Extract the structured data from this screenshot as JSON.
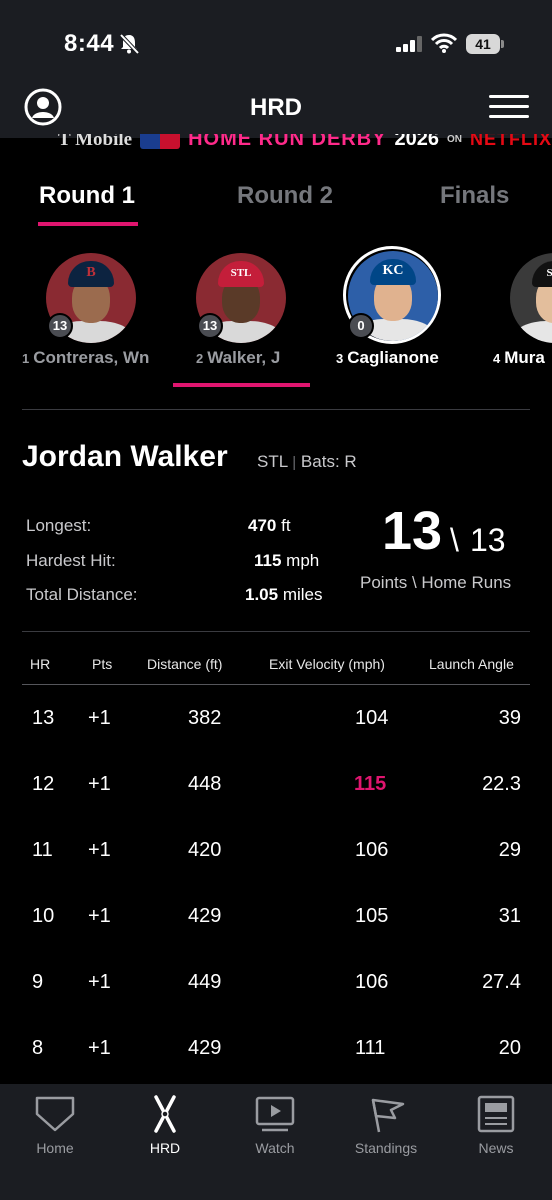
{
  "status": {
    "time": "8:44",
    "battery": "41"
  },
  "header": {
    "title": "HRD"
  },
  "sponsor": {
    "brand": "T Mobile",
    "event": "HOME RUN DERBY",
    "year": "2026",
    "on": "ON",
    "partner": "NETFLIX"
  },
  "tabs": [
    {
      "label": "Round 1",
      "active": true
    },
    {
      "label": "Round 2",
      "active": false
    },
    {
      "label": "Finals",
      "active": false
    }
  ],
  "players": [
    {
      "seed": "1",
      "name": "Contreras, Wn",
      "score": "13",
      "team_logo": "B",
      "cap_color": "#0c2340",
      "accent": "#bd3039"
    },
    {
      "seed": "2",
      "name": "Walker, J",
      "score": "13",
      "team_logo": "STL",
      "cap_color": "#c41e3a",
      "accent": "#ffffff",
      "selected": true
    },
    {
      "seed": "3",
      "name": "Caglianone",
      "score": "0",
      "team_logo": "KC",
      "cap_color": "#004687",
      "accent": "#ffffff"
    },
    {
      "seed": "4",
      "name": "Mura",
      "team_logo": "Sox",
      "cap_color": "#111111",
      "accent": "#ffffff"
    }
  ],
  "detail": {
    "name": "Jordan Walker",
    "team": "STL",
    "sep": "|",
    "bats": "Bats: R",
    "stats": [
      {
        "label": "Longest:",
        "value": "470",
        "unit": "ft"
      },
      {
        "label": "Hardest Hit:",
        "value": "115",
        "unit": "mph"
      },
      {
        "label": "Total Distance:",
        "value": "1.05",
        "unit": "miles"
      }
    ],
    "points": "13",
    "sep_big": "\\",
    "home_runs": "13",
    "caption": "Points \\ Home Runs"
  },
  "table": {
    "headers": [
      "HR",
      "Pts",
      "Distance (ft)",
      "Exit Velocity (mph)",
      "Launch Angle"
    ],
    "rows": [
      {
        "hr": "13",
        "pts": "+1",
        "distance": "382",
        "ev": "104",
        "la": "39"
      },
      {
        "hr": "12",
        "pts": "+1",
        "distance": "448",
        "ev": "115",
        "la": "22.3",
        "highlight": true
      },
      {
        "hr": "11",
        "pts": "+1",
        "distance": "420",
        "ev": "106",
        "la": "29"
      },
      {
        "hr": "10",
        "pts": "+1",
        "distance": "429",
        "ev": "105",
        "la": "31"
      },
      {
        "hr": "9",
        "pts": "+1",
        "distance": "449",
        "ev": "106",
        "la": "27.4"
      },
      {
        "hr": "8",
        "pts": "+1",
        "distance": "429",
        "ev": "111",
        "la": "20"
      }
    ]
  },
  "nav": [
    {
      "label": "Home",
      "icon": "home-plate-icon"
    },
    {
      "label": "HRD",
      "icon": "crossed-bats-icon",
      "active": true
    },
    {
      "label": "Watch",
      "icon": "play-screen-icon"
    },
    {
      "label": "Standings",
      "icon": "pennant-icon"
    },
    {
      "label": "News",
      "icon": "newspaper-icon"
    }
  ],
  "colors": {
    "accent": "#e0156f",
    "bar_bg": "#1b1d22",
    "bg": "#000000",
    "muted": "#75777c"
  }
}
